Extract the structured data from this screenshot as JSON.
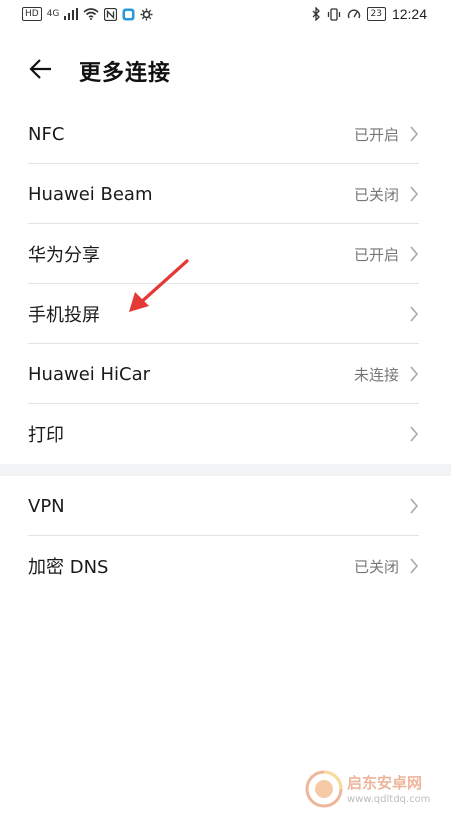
{
  "status_bar": {
    "left_badges": [
      "HD",
      "4G"
    ],
    "battery": "23",
    "time": "12:24"
  },
  "header": {
    "back_icon": "arrow-left-icon",
    "title": "更多连接"
  },
  "groups": [
    {
      "items": [
        {
          "label": "NFC",
          "value": "已开启"
        },
        {
          "label": "Huawei Beam",
          "value": "已关闭"
        },
        {
          "label": "华为分享",
          "value": "已开启"
        },
        {
          "label": "手机投屏",
          "value": ""
        },
        {
          "label": "Huawei HiCar",
          "value": "未连接"
        },
        {
          "label": "打印",
          "value": ""
        }
      ]
    },
    {
      "items": [
        {
          "label": "VPN",
          "value": ""
        },
        {
          "label": "加密 DNS",
          "value": "已关闭"
        }
      ]
    }
  ],
  "colors": {
    "annotation_arrow": "#e53935",
    "watermark": "#e07b4c"
  },
  "watermark": {
    "title": "启东安卓网",
    "url": "www.qdltdq.com"
  }
}
